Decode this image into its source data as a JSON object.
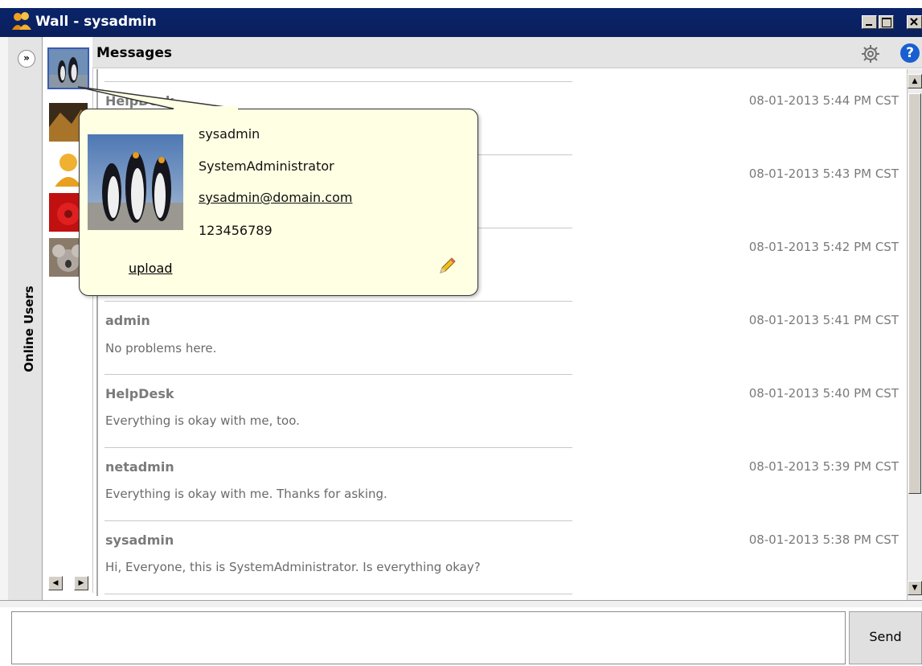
{
  "window": {
    "title": "Wall - sysadmin"
  },
  "sidebar": {
    "label": "Online Users",
    "expand_label": "»"
  },
  "header": {
    "title": "Messages"
  },
  "messages": [
    {
      "user": "HelpDesk",
      "time": "08-01-2013 5:44 PM CST",
      "text": ""
    },
    {
      "user": "",
      "time": "08-01-2013 5:43 PM CST",
      "text": ""
    },
    {
      "user": "",
      "time": "08-01-2013 5:42 PM CST",
      "text": ""
    },
    {
      "user": "admin",
      "time": "08-01-2013 5:41 PM CST",
      "text": "No problems here."
    },
    {
      "user": "HelpDesk",
      "time": "08-01-2013 5:40 PM CST",
      "text": "Everything is okay with me, too."
    },
    {
      "user": "netadmin",
      "time": "08-01-2013 5:39 PM CST",
      "text": "Everything is okay with me. Thanks for asking."
    },
    {
      "user": "sysadmin",
      "time": "08-01-2013 5:38 PM CST",
      "text": "Hi, Everyone, this is SystemAdministrator. Is everything okay?"
    }
  ],
  "profile": {
    "username": "sysadmin",
    "fullname": "SystemAdministrator",
    "email": "sysadmin@domain.com",
    "phone": "123456789",
    "upload_label": "upload"
  },
  "composer": {
    "send_label": "Send"
  },
  "icons": {
    "app": "users-icon",
    "gear": "gear-icon",
    "help": "help-icon",
    "edit": "pencil-icon",
    "minimize": "minimize-icon",
    "maximize": "maximize-icon",
    "close": "close-icon"
  },
  "colors": {
    "titlebar": "#0a246a",
    "popup_bg": "#ffffe3",
    "help_blue": "#1a5fd0"
  }
}
